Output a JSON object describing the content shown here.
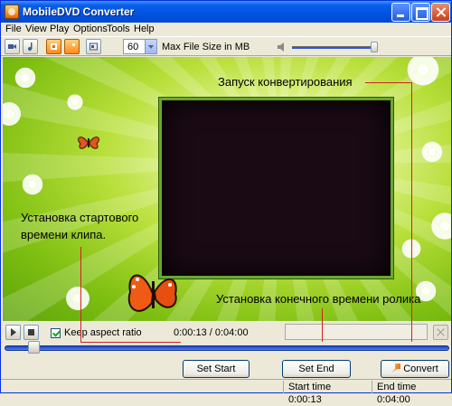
{
  "window": {
    "title": "MobileDVD Converter"
  },
  "menu": [
    "File",
    "View",
    "Play",
    "Options",
    "Tools",
    "Help"
  ],
  "toolbar": {
    "file_size_value": "60",
    "file_size_label": "Max File Size in MB",
    "volume_level": 1.0
  },
  "annotations": {
    "convert_start": "Запуск конвертирования",
    "start_time_line1": "Установка стартового",
    "start_time_line2": "времени клипа.",
    "end_time": "Установка конечного времени ролика"
  },
  "controls": {
    "keep_aspect_label": "Keep aspect ratio",
    "keep_aspect_checked": true,
    "time_readout": "0:00:13 / 0:04:00",
    "seek_position": 0.054,
    "set_start_label": "Set Start",
    "set_end_label": "Set End",
    "convert_label": "Convert"
  },
  "status": {
    "start_time_label": "Start time",
    "start_time_value": "0:00:13",
    "end_time_label": "End time",
    "end_time_value": "0:04:00"
  },
  "colors": {
    "annotation_line": "#d42020",
    "accent": "#0053e1"
  }
}
